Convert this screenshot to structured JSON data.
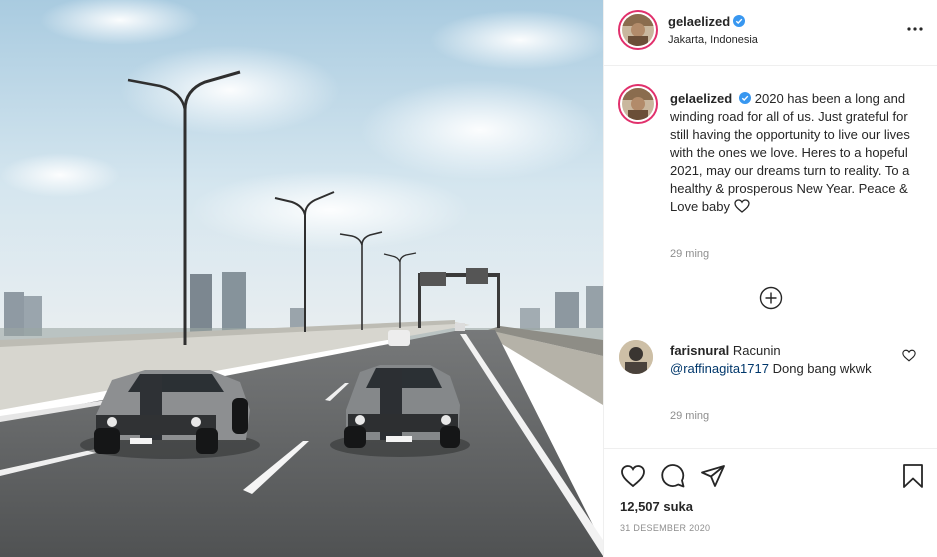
{
  "post": {
    "username": "gelaelized",
    "location": "Jakarta, Indonesia",
    "caption": "2020 has been a long and winding road for all of us. Just grateful for still having the opportunity to live our lives with the ones we love. Heres to a hopeful 2021, may our dreams turn to reality. To a healthy & prosperous New Year. Peace & Love baby",
    "caption_time": "29 ming",
    "likes": "12,507 suka",
    "date": "31 DESEMBER 2020"
  },
  "comment": {
    "username": "farisnural",
    "text_before": "Racunin",
    "mention": "@raffinagita1717",
    "text_after": "Dong bang wkwk",
    "time": "29 ming"
  },
  "icons": {
    "verified": "verified-badge-icon",
    "more": "more-options-icon",
    "add_comment": "plus-circle-icon",
    "like": "heart-icon",
    "comment": "comment-bubble-icon",
    "share": "paper-plane-icon",
    "save": "bookmark-icon"
  },
  "colors": {
    "verified_blue": "#3897f0",
    "story_ring": "#e1306c",
    "text": "#262626",
    "secondary_text": "#8e8e8e",
    "link": "#00376b"
  }
}
